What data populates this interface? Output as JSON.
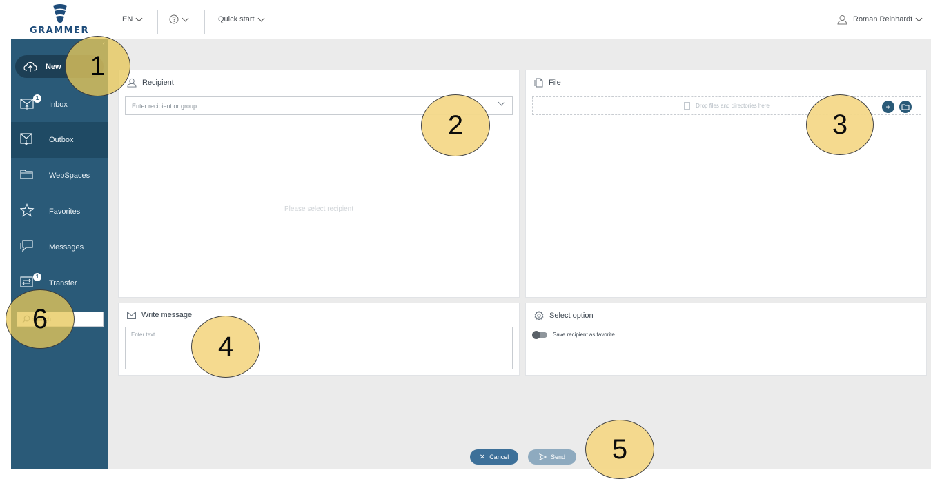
{
  "brand": {
    "name": "GRAMMER"
  },
  "topbar": {
    "language": "EN",
    "quick_start": "Quick start",
    "user_name": "Roman Reinhardt"
  },
  "sidebar": {
    "collapse_glyph": "‹",
    "new_label": "New",
    "items": [
      {
        "label": "Inbox",
        "icon": "inbox-icon",
        "badge": "1",
        "active": false
      },
      {
        "label": "Outbox",
        "icon": "outbox-icon",
        "badge": "",
        "active": true
      },
      {
        "label": "WebSpaces",
        "icon": "folder-icon",
        "badge": "",
        "active": false
      },
      {
        "label": "Favorites",
        "icon": "star-icon",
        "badge": "",
        "active": false
      },
      {
        "label": "Messages",
        "icon": "chat-icon",
        "badge": "",
        "active": false
      },
      {
        "label": "Transfer",
        "icon": "transfer-icon",
        "badge": "1",
        "active": false
      }
    ],
    "search_placeholder": "search"
  },
  "recipient_panel": {
    "title": "Recipient",
    "input_placeholder": "Enter recipient or group",
    "empty_text": "Please select recipient"
  },
  "file_panel": {
    "title": "File",
    "drop_text": "Drop files and directories here"
  },
  "message_panel": {
    "title": "Write message",
    "placeholder": "Enter text"
  },
  "options_panel": {
    "title": "Select option",
    "toggle_label": "Save recipient as favorite",
    "toggle_on": false
  },
  "actions": {
    "cancel_label": "Cancel",
    "send_label": "Send"
  },
  "callouts": [
    "1",
    "2",
    "3",
    "4",
    "5",
    "6"
  ],
  "colors": {
    "sidebar": "#2a5a78",
    "sidebar_active": "#1f4a64",
    "cancel_button": "#3d7099",
    "send_button": "#8eaabf",
    "callout": "#f5d98a"
  }
}
